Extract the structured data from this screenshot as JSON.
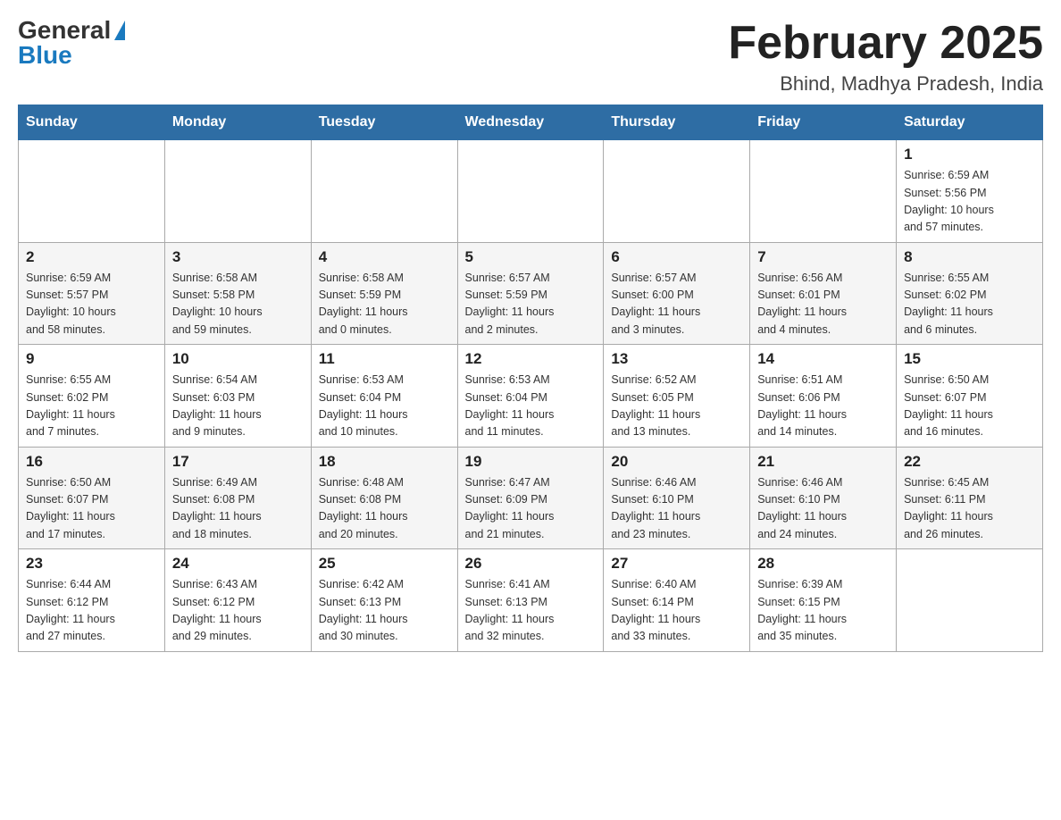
{
  "logo": {
    "general": "General",
    "blue": "Blue"
  },
  "title": "February 2025",
  "location": "Bhind, Madhya Pradesh, India",
  "days_of_week": [
    "Sunday",
    "Monday",
    "Tuesday",
    "Wednesday",
    "Thursday",
    "Friday",
    "Saturday"
  ],
  "weeks": [
    [
      {
        "day": "",
        "info": ""
      },
      {
        "day": "",
        "info": ""
      },
      {
        "day": "",
        "info": ""
      },
      {
        "day": "",
        "info": ""
      },
      {
        "day": "",
        "info": ""
      },
      {
        "day": "",
        "info": ""
      },
      {
        "day": "1",
        "info": "Sunrise: 6:59 AM\nSunset: 5:56 PM\nDaylight: 10 hours\nand 57 minutes."
      }
    ],
    [
      {
        "day": "2",
        "info": "Sunrise: 6:59 AM\nSunset: 5:57 PM\nDaylight: 10 hours\nand 58 minutes."
      },
      {
        "day": "3",
        "info": "Sunrise: 6:58 AM\nSunset: 5:58 PM\nDaylight: 10 hours\nand 59 minutes."
      },
      {
        "day": "4",
        "info": "Sunrise: 6:58 AM\nSunset: 5:59 PM\nDaylight: 11 hours\nand 0 minutes."
      },
      {
        "day": "5",
        "info": "Sunrise: 6:57 AM\nSunset: 5:59 PM\nDaylight: 11 hours\nand 2 minutes."
      },
      {
        "day": "6",
        "info": "Sunrise: 6:57 AM\nSunset: 6:00 PM\nDaylight: 11 hours\nand 3 minutes."
      },
      {
        "day": "7",
        "info": "Sunrise: 6:56 AM\nSunset: 6:01 PM\nDaylight: 11 hours\nand 4 minutes."
      },
      {
        "day": "8",
        "info": "Sunrise: 6:55 AM\nSunset: 6:02 PM\nDaylight: 11 hours\nand 6 minutes."
      }
    ],
    [
      {
        "day": "9",
        "info": "Sunrise: 6:55 AM\nSunset: 6:02 PM\nDaylight: 11 hours\nand 7 minutes."
      },
      {
        "day": "10",
        "info": "Sunrise: 6:54 AM\nSunset: 6:03 PM\nDaylight: 11 hours\nand 9 minutes."
      },
      {
        "day": "11",
        "info": "Sunrise: 6:53 AM\nSunset: 6:04 PM\nDaylight: 11 hours\nand 10 minutes."
      },
      {
        "day": "12",
        "info": "Sunrise: 6:53 AM\nSunset: 6:04 PM\nDaylight: 11 hours\nand 11 minutes."
      },
      {
        "day": "13",
        "info": "Sunrise: 6:52 AM\nSunset: 6:05 PM\nDaylight: 11 hours\nand 13 minutes."
      },
      {
        "day": "14",
        "info": "Sunrise: 6:51 AM\nSunset: 6:06 PM\nDaylight: 11 hours\nand 14 minutes."
      },
      {
        "day": "15",
        "info": "Sunrise: 6:50 AM\nSunset: 6:07 PM\nDaylight: 11 hours\nand 16 minutes."
      }
    ],
    [
      {
        "day": "16",
        "info": "Sunrise: 6:50 AM\nSunset: 6:07 PM\nDaylight: 11 hours\nand 17 minutes."
      },
      {
        "day": "17",
        "info": "Sunrise: 6:49 AM\nSunset: 6:08 PM\nDaylight: 11 hours\nand 18 minutes."
      },
      {
        "day": "18",
        "info": "Sunrise: 6:48 AM\nSunset: 6:08 PM\nDaylight: 11 hours\nand 20 minutes."
      },
      {
        "day": "19",
        "info": "Sunrise: 6:47 AM\nSunset: 6:09 PM\nDaylight: 11 hours\nand 21 minutes."
      },
      {
        "day": "20",
        "info": "Sunrise: 6:46 AM\nSunset: 6:10 PM\nDaylight: 11 hours\nand 23 minutes."
      },
      {
        "day": "21",
        "info": "Sunrise: 6:46 AM\nSunset: 6:10 PM\nDaylight: 11 hours\nand 24 minutes."
      },
      {
        "day": "22",
        "info": "Sunrise: 6:45 AM\nSunset: 6:11 PM\nDaylight: 11 hours\nand 26 minutes."
      }
    ],
    [
      {
        "day": "23",
        "info": "Sunrise: 6:44 AM\nSunset: 6:12 PM\nDaylight: 11 hours\nand 27 minutes."
      },
      {
        "day": "24",
        "info": "Sunrise: 6:43 AM\nSunset: 6:12 PM\nDaylight: 11 hours\nand 29 minutes."
      },
      {
        "day": "25",
        "info": "Sunrise: 6:42 AM\nSunset: 6:13 PM\nDaylight: 11 hours\nand 30 minutes."
      },
      {
        "day": "26",
        "info": "Sunrise: 6:41 AM\nSunset: 6:13 PM\nDaylight: 11 hours\nand 32 minutes."
      },
      {
        "day": "27",
        "info": "Sunrise: 6:40 AM\nSunset: 6:14 PM\nDaylight: 11 hours\nand 33 minutes."
      },
      {
        "day": "28",
        "info": "Sunrise: 6:39 AM\nSunset: 6:15 PM\nDaylight: 11 hours\nand 35 minutes."
      },
      {
        "day": "",
        "info": ""
      }
    ]
  ]
}
